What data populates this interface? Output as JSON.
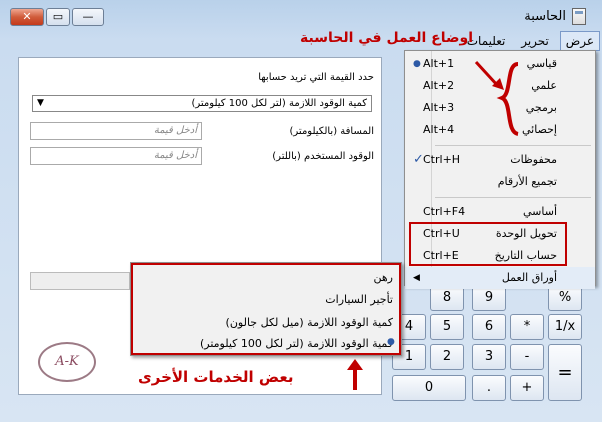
{
  "window": {
    "title": "الحاسبة",
    "close_label": "✕",
    "max_label": "▭",
    "min_label": "—"
  },
  "menubar": {
    "items": [
      "عرض",
      "تحرير",
      "تعليمات"
    ]
  },
  "annotation_top": "اوضاع العمل في الحاسبة",
  "annotation_bottom": "بعض الخدمات الأخرى",
  "left_panel": {
    "heading": "حدد القيمة التي تريد حسابها",
    "select_value": "كمية الوقود اللازمة (لتر لكل 100 كيلومتر)",
    "distance_label": "المسافة (بالكيلومتر)",
    "distance_placeholder": "أدخل قيمة",
    "fuel_label": "الوقود المستخدم (باللتر)",
    "fuel_placeholder": "أدخل قيمة",
    "logo_text": "A-K"
  },
  "view_menu": {
    "items": [
      {
        "label": "قياسي",
        "shortcut": "Alt+1",
        "selected": true
      },
      {
        "label": "علمي",
        "shortcut": "Alt+2"
      },
      {
        "label": "برمجي",
        "shortcut": "Alt+3"
      },
      {
        "label": "إحصائي",
        "shortcut": "Alt+4"
      },
      {
        "label": "محفوظات",
        "shortcut": "Ctrl+H",
        "checked": true
      },
      {
        "label": "تجميع الأرقام",
        "shortcut": ""
      },
      {
        "label": "أساسي",
        "shortcut": "Ctrl+F4"
      },
      {
        "label": "تحويل الوحدة",
        "shortcut": "Ctrl+U"
      },
      {
        "label": "حساب التاريخ",
        "shortcut": "Ctrl+E"
      },
      {
        "label": "أوراق العمل",
        "shortcut": ""
      }
    ]
  },
  "worksheets_submenu": {
    "items": [
      "رهن",
      "تأجير السيارات",
      "كمية الوقود اللازمة (ميل لكل جالون)",
      "كمية الوقود اللازمة (لتر لكل 100 كيلومتر)"
    ]
  },
  "keypad": {
    "row1": [
      "8",
      "9",
      "%"
    ],
    "row2": [
      "4",
      "5",
      "6",
      "*",
      "1/x"
    ],
    "row3": [
      "1",
      "2",
      "3",
      "-"
    ],
    "row4": [
      "0",
      ".",
      "+"
    ],
    "equals": "="
  },
  "colors": {
    "annotation": "#c00000"
  }
}
